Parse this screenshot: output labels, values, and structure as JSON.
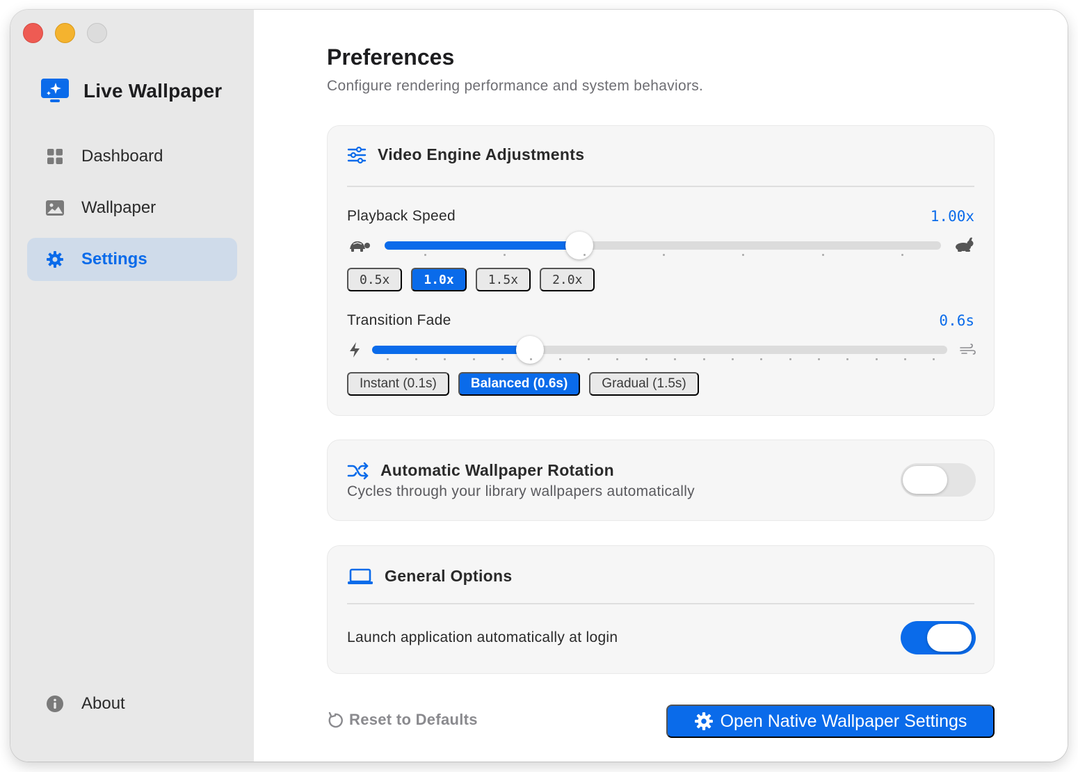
{
  "app": {
    "name": "Live Wallpaper"
  },
  "sidebar": {
    "items": [
      {
        "label": "Dashboard",
        "icon": "grid-icon",
        "active": false
      },
      {
        "label": "Wallpaper",
        "icon": "photo-icon",
        "active": false
      },
      {
        "label": "Settings",
        "icon": "gear-icon",
        "active": true
      }
    ],
    "footer": {
      "label": "About",
      "icon": "info-icon"
    }
  },
  "header": {
    "title": "Preferences",
    "subtitle": "Configure rendering performance and system behaviors."
  },
  "video_engine": {
    "title": "Video Engine Adjustments",
    "playback": {
      "label": "Playback Speed",
      "value": "1.00x",
      "level": 0.35,
      "presets": [
        "0.5x",
        "1.0x",
        "1.5x",
        "2.0x"
      ],
      "selected": "1.0x"
    },
    "fade": {
      "label": "Transition Fade",
      "value": "0.6s",
      "level": 0.275,
      "presets": [
        "Instant (0.1s)",
        "Balanced (0.6s)",
        "Gradual (1.5s)"
      ],
      "selected": "Balanced (0.6s)"
    }
  },
  "rotation": {
    "title": "Automatic Wallpaper Rotation",
    "description": "Cycles through your library wallpapers automatically",
    "enabled": false
  },
  "general": {
    "title": "General Options",
    "launch_at_login": {
      "label": "Launch application automatically at login",
      "enabled": true
    }
  },
  "footer": {
    "reset_label": "Reset to Defaults",
    "open_settings_label": "Open Native Wallpaper Settings"
  },
  "colors": {
    "accent": "#0a6bea",
    "sidebar_bg": "#e8e8e8",
    "card_bg": "#f6f6f6"
  }
}
